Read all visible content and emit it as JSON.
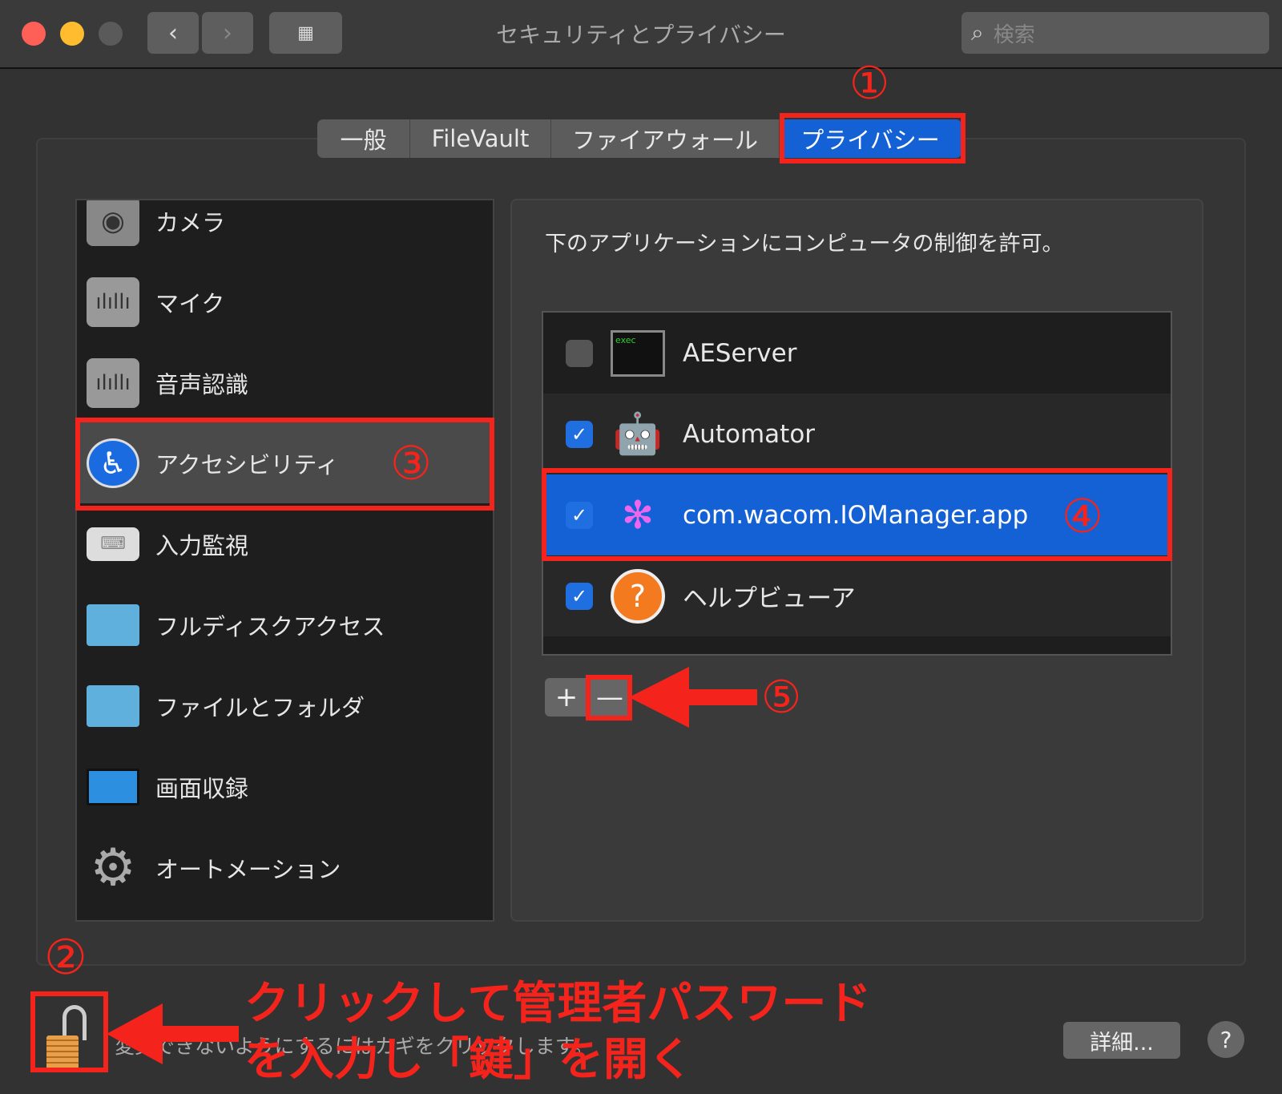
{
  "window": {
    "title": "セキュリティとプライバシー",
    "search_placeholder": "検索"
  },
  "tabs": [
    {
      "label": "一般"
    },
    {
      "label": "FileVault"
    },
    {
      "label": "ファイアウォール"
    },
    {
      "label": "プライバシー",
      "selected": true
    }
  ],
  "sidebar": {
    "items": [
      {
        "label": "カメラ",
        "icon": "camera-icon"
      },
      {
        "label": "マイク",
        "icon": "microphone-icon"
      },
      {
        "label": "音声認識",
        "icon": "speech-recognition-icon"
      },
      {
        "label": "アクセシビリティ",
        "icon": "accessibility-icon",
        "selected": true
      },
      {
        "label": "入力監視",
        "icon": "keyboard-icon"
      },
      {
        "label": "フルディスクアクセス",
        "icon": "folder-icon"
      },
      {
        "label": "ファイルとフォルダ",
        "icon": "folder-icon"
      },
      {
        "label": "画面収録",
        "icon": "display-icon"
      },
      {
        "label": "オートメーション",
        "icon": "gear-icon"
      }
    ]
  },
  "main": {
    "description": "下のアプリケーションにコンピュータの制御を許可。",
    "apps": [
      {
        "name": "AEServer",
        "checked": false,
        "icon_text": "exec"
      },
      {
        "name": "Automator",
        "checked": true
      },
      {
        "name": "com.wacom.IOManager.app",
        "checked": true,
        "selected": true
      },
      {
        "name": "ヘルプビューア",
        "checked": true
      }
    ],
    "add_label": "+",
    "remove_label": "—"
  },
  "footer": {
    "lock_hint": "変更できないようにするにはカギをクリックします。",
    "advanced_label": "詳細...",
    "help_label": "?"
  },
  "annotations": {
    "n1": "①",
    "n2": "②",
    "n3": "③",
    "n4": "④",
    "n5": "⑤",
    "line1": "クリックして管理者パスワード",
    "line2": "を入力し「鍵」を開く"
  },
  "colors": {
    "accent": "#1461d6",
    "annotation": "#f4241c"
  }
}
